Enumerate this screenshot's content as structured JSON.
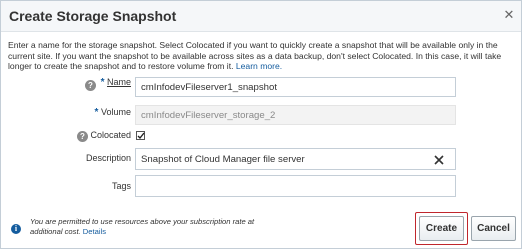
{
  "dialog": {
    "title": "Create Storage Snapshot",
    "close_glyph": "✕"
  },
  "intro": {
    "text": "Enter a name for the storage snapshot. Select Colocated if you want to quickly create a snapshot that will be available only in the current site. If you want the snapshot to be available across sites as a data backup, don't select Colocated. In this case, it will take longer to create the snapshot and to restore volume from it.",
    "link": "Learn more."
  },
  "form": {
    "required_mark": "*",
    "help_glyph": "?",
    "name": {
      "label": "Name",
      "value": "cmInfodevFileserver1_snapshot"
    },
    "volume": {
      "label": "Volume",
      "value": "cmInfodevFileserver_storage_2"
    },
    "colocated": {
      "label": "Colocated",
      "checked": true
    },
    "description": {
      "label": "Description",
      "value": "Snapshot of Cloud Manager file server"
    },
    "tags": {
      "label": "Tags",
      "value": ""
    }
  },
  "footer": {
    "info_glyph": "i",
    "note": "You are permitted to use resources above your subscription rate at additional cost.",
    "details_link": "Details",
    "create_label": "Create",
    "cancel_label": "Cancel"
  },
  "colors": {
    "accent": "#145c9e",
    "focus_ring": "#c0272d"
  },
  "icons": {
    "close": "close-icon",
    "help": "help-icon",
    "clear": "clear-icon",
    "check": "check-icon",
    "info": "info-icon"
  }
}
